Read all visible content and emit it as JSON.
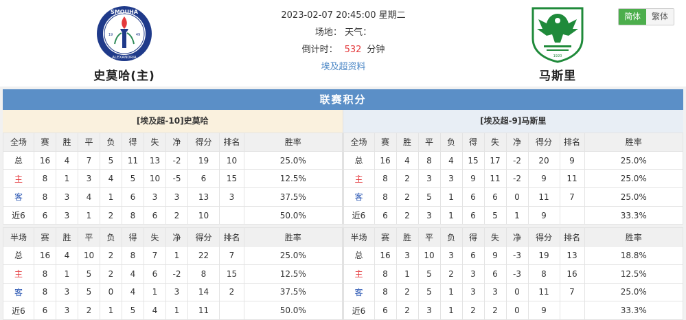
{
  "header": {
    "datetime": "2023-02-07 20:45:00 星期二",
    "venue_label": "场地：",
    "weather_label": "天气：",
    "countdown_label": "倒计时：",
    "countdown_value": "532",
    "countdown_unit": "分钟",
    "league_link": "埃及超资料",
    "home_team": {
      "name": "史莫哈(主)",
      "logo_text": "SMOUHA",
      "logo_sub": "ALEXANDRIA",
      "logo_year_l": "19",
      "logo_year_r": "49"
    },
    "away_team": {
      "name": "马斯里",
      "logo_text": "1920"
    },
    "lang": {
      "simplified": "简体",
      "traditional": "繁体"
    }
  },
  "colors": {
    "accent_blue": "#5b8fc7",
    "active_green": "#4cae4c",
    "home_red": "#e4393c",
    "away_blue": "#2b57b3"
  },
  "standings": {
    "title": "联赛积分",
    "columns_full": [
      "全场",
      "赛",
      "胜",
      "平",
      "负",
      "得",
      "失",
      "净",
      "得分",
      "排名",
      "胜率"
    ],
    "columns_half": [
      "半场",
      "赛",
      "胜",
      "平",
      "负",
      "得",
      "失",
      "净",
      "得分",
      "排名",
      "胜率"
    ],
    "left": {
      "team_title": "[埃及超-10]史莫哈",
      "full": [
        [
          "总",
          "16",
          "4",
          "7",
          "5",
          "11",
          "13",
          "-2",
          "19",
          "10",
          "25.0%"
        ],
        [
          "主",
          "8",
          "1",
          "3",
          "4",
          "5",
          "10",
          "-5",
          "6",
          "15",
          "12.5%"
        ],
        [
          "客",
          "8",
          "3",
          "4",
          "1",
          "6",
          "3",
          "3",
          "13",
          "3",
          "37.5%"
        ],
        [
          "近6",
          "6",
          "3",
          "1",
          "2",
          "8",
          "6",
          "2",
          "10",
          "",
          "50.0%"
        ]
      ],
      "half": [
        [
          "总",
          "16",
          "4",
          "10",
          "2",
          "8",
          "7",
          "1",
          "22",
          "7",
          "25.0%"
        ],
        [
          "主",
          "8",
          "1",
          "5",
          "2",
          "4",
          "6",
          "-2",
          "8",
          "15",
          "12.5%"
        ],
        [
          "客",
          "8",
          "3",
          "5",
          "0",
          "4",
          "1",
          "3",
          "14",
          "2",
          "37.5%"
        ],
        [
          "近6",
          "6",
          "3",
          "2",
          "1",
          "5",
          "4",
          "1",
          "11",
          "",
          "50.0%"
        ]
      ]
    },
    "right": {
      "team_title": "[埃及超-9]马斯里",
      "full": [
        [
          "总",
          "16",
          "4",
          "8",
          "4",
          "15",
          "17",
          "-2",
          "20",
          "9",
          "25.0%"
        ],
        [
          "主",
          "8",
          "2",
          "3",
          "3",
          "9",
          "11",
          "-2",
          "9",
          "11",
          "25.0%"
        ],
        [
          "客",
          "8",
          "2",
          "5",
          "1",
          "6",
          "6",
          "0",
          "11",
          "7",
          "25.0%"
        ],
        [
          "近6",
          "6",
          "2",
          "3",
          "1",
          "6",
          "5",
          "1",
          "9",
          "",
          "33.3%"
        ]
      ],
      "half": [
        [
          "总",
          "16",
          "3",
          "10",
          "3",
          "6",
          "9",
          "-3",
          "19",
          "13",
          "18.8%"
        ],
        [
          "主",
          "8",
          "1",
          "5",
          "2",
          "3",
          "6",
          "-3",
          "8",
          "16",
          "12.5%"
        ],
        [
          "客",
          "8",
          "2",
          "5",
          "1",
          "3",
          "3",
          "0",
          "11",
          "7",
          "25.0%"
        ],
        [
          "近6",
          "6",
          "2",
          "3",
          "1",
          "2",
          "2",
          "0",
          "9",
          "",
          "33.3%"
        ]
      ]
    }
  }
}
